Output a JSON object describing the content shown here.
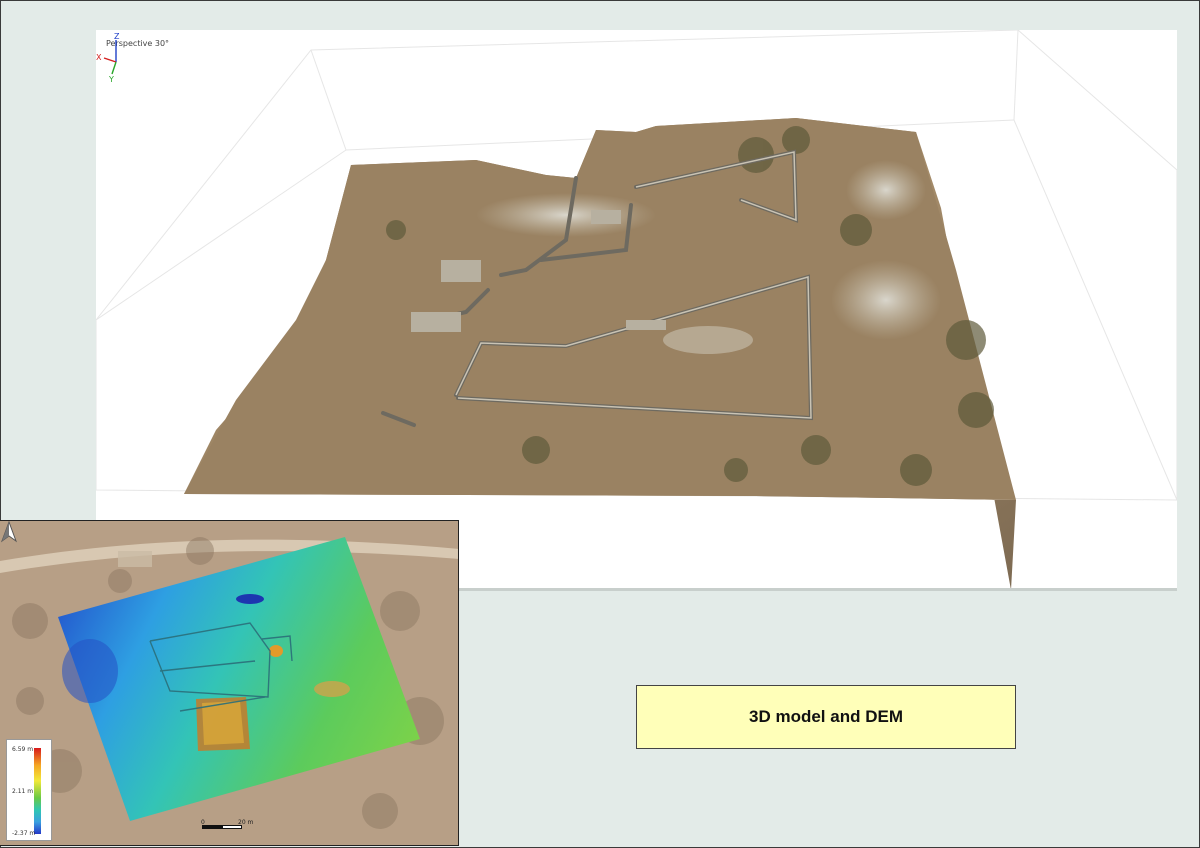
{
  "viewport": {
    "perspective_label": "Perspective 30°",
    "axes": {
      "x": "X",
      "y": "Y",
      "z": "Z"
    },
    "axis_colors": {
      "x": "#d42020",
      "y": "#28a528",
      "z": "#2040c8"
    }
  },
  "dem": {
    "legend": {
      "max": "6.59 m",
      "mid": "2.11 m",
      "min": "-2.37 m"
    },
    "scale": {
      "start": "0",
      "end": "20 m"
    },
    "north_arrow_icon": "north-arrow-icon"
  },
  "title": "3D model and DEM",
  "colors": {
    "title_bg": "#ffffb9",
    "page_bg": "#e3ebe8"
  }
}
